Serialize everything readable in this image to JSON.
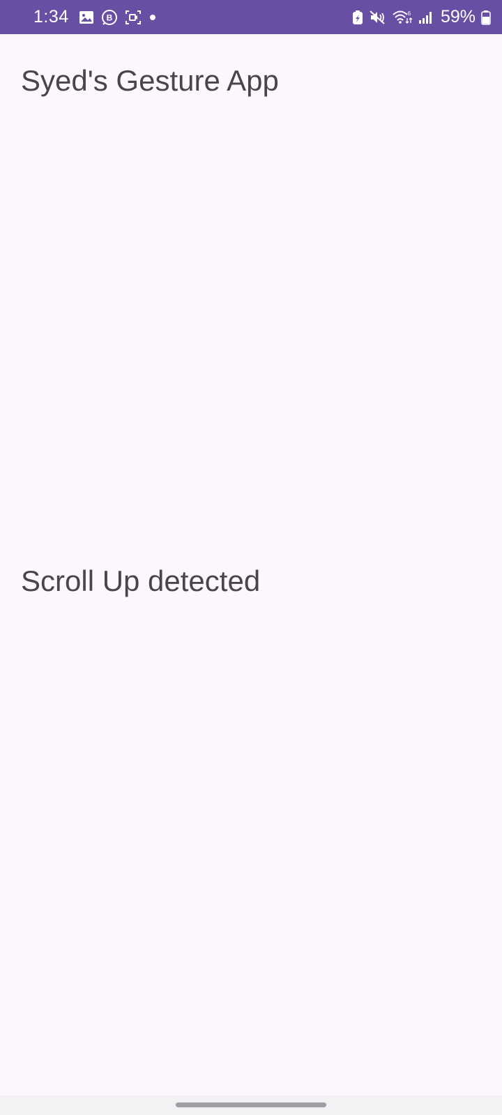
{
  "status_bar": {
    "time": "1:34",
    "battery_percent": "59%",
    "background_color": "#6750a4",
    "left_icons": [
      "gallery-icon",
      "b-notification-icon",
      "screen-record-icon",
      "dot-icon"
    ],
    "right_icons": [
      "battery-saver-icon",
      "mute-icon",
      "wifi-icon",
      "signal-icon",
      "battery-icon"
    ]
  },
  "app": {
    "title": "Syed's Gesture App",
    "gesture_status": "Scroll Up detected",
    "background_color": "#fcf7fc",
    "text_color": "#48464c"
  }
}
